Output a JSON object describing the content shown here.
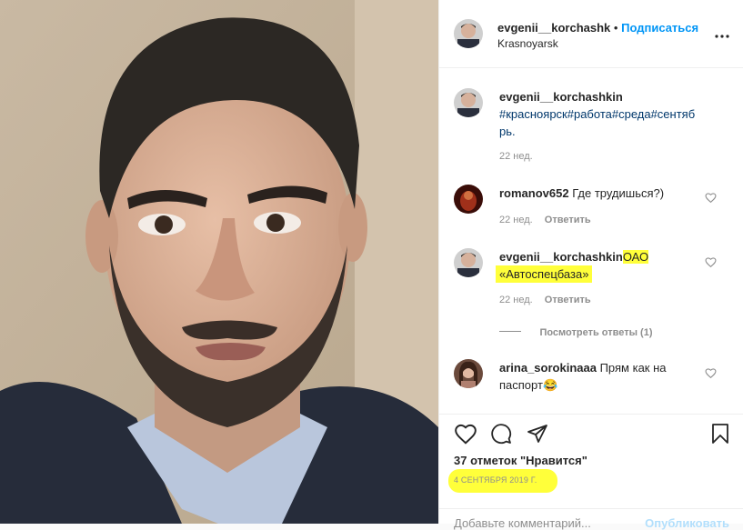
{
  "header": {
    "username": "evgenii__korchashk",
    "separator": "•",
    "follow_label": "Подписаться",
    "location": "Krasnoyarsk",
    "more_icon": "more-dots-icon"
  },
  "caption": {
    "username": "evgenii__korchashkin",
    "hashtags_line1": "#красноярск#работа#среда#сентяб",
    "hashtags_line2": "рь.",
    "time": "22 нед."
  },
  "comments": [
    {
      "username": "romanov652",
      "text": "Где трудишься?)",
      "time": "22 нед.",
      "reply_label": "Ответить"
    },
    {
      "username": "evgenii__korchashkin",
      "text_line1": "ОАО",
      "text_line2": "«Автоспецбаза»",
      "time": "22 нед.",
      "reply_label": "Ответить"
    },
    {
      "username": "arina_sorokinaaa",
      "text_line1": "Прям как на",
      "text_line2": "паспорт",
      "emoji": "😂"
    }
  ],
  "view_replies_label": "Посмотреть ответы (1)",
  "likes_label": "37 отметок \"Нравится\"",
  "date_label": "4 СЕНТЯБРЯ 2019 Г.",
  "add_comment_placeholder": "Добавьте комментарий...",
  "post_label": "Опубликовать",
  "colors": {
    "accent": "#0095f6",
    "highlight": "#ffff3a",
    "meta": "#8e8e8e",
    "link": "#00376b"
  }
}
